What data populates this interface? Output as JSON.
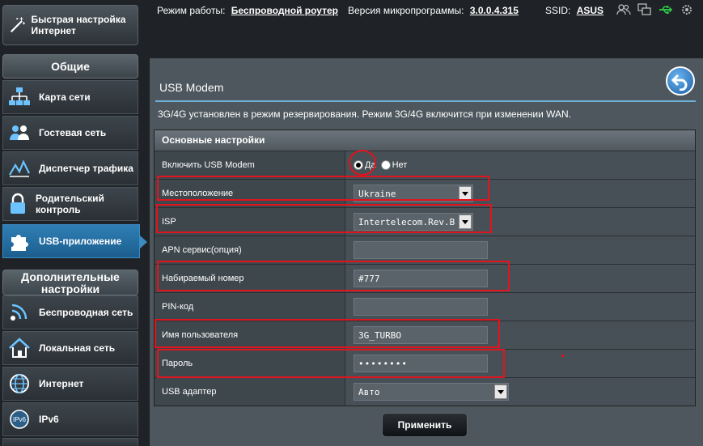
{
  "topbar": {
    "mode_label": "Режим работы:",
    "mode_value": "Беспроводной роутер",
    "fw_label": "Версия микропрограммы:",
    "fw_value": "3.0.0.4.315",
    "ssid_label": "SSID:",
    "ssid_value": "ASUS",
    "icons": [
      "users-icon",
      "copy-icon",
      "usb-icon",
      "settings-icon"
    ]
  },
  "sidebar": {
    "quick_setup": "Быстрая настройка Интернет",
    "general_header": "Общие",
    "general_items": [
      {
        "label": "Карта сети",
        "icon": "network-map-icon"
      },
      {
        "label": "Гостевая сеть",
        "icon": "guest-network-icon"
      },
      {
        "label": "Диспетчер трафика",
        "icon": "traffic-icon"
      },
      {
        "label": "Родительский контроль",
        "icon": "parental-lock-icon"
      },
      {
        "label": "USB-приложение",
        "icon": "usb-puzzle-icon",
        "active": true
      }
    ],
    "advanced_header": "Дополнительные настройки",
    "advanced_items": [
      {
        "label": "Беспроводная сеть",
        "icon": "wireless-icon"
      },
      {
        "label": "Локальная сеть",
        "icon": "home-icon"
      },
      {
        "label": "Интернет",
        "icon": "globe-icon"
      },
      {
        "label": "IPv6",
        "icon": "ipv6-icon"
      }
    ]
  },
  "main": {
    "title": "USB Modem",
    "notice": "3G/4G установлен в режим резервирования. Режим 3G/4G включится при изменении WAN.",
    "section_title": "Основные настройки",
    "rows": {
      "enable_label": "Включить USB Modem",
      "enable_yes": "Да",
      "enable_no": "Нет",
      "location_label": "Местоположение",
      "location_value": "Ukraine",
      "isp_label": "ISP",
      "isp_value": "Intertelecom.Rev.B",
      "apn_label": "APN сервис(опция)",
      "apn_value": "",
      "dial_label": "Набираемый номер",
      "dial_value": "#777",
      "pin_label": "PIN-код",
      "pin_value": "",
      "user_label": "Имя пользователя",
      "user_value": "3G_TURBO",
      "pass_label": "Пароль",
      "pass_value": "••••••••",
      "adapter_label": "USB адаптер",
      "adapter_value": "Авто"
    },
    "apply_label": "Применить"
  },
  "colors": {
    "accent": "#2f7fb5",
    "annotation": "#e0141e",
    "panel": "#4d575d"
  }
}
